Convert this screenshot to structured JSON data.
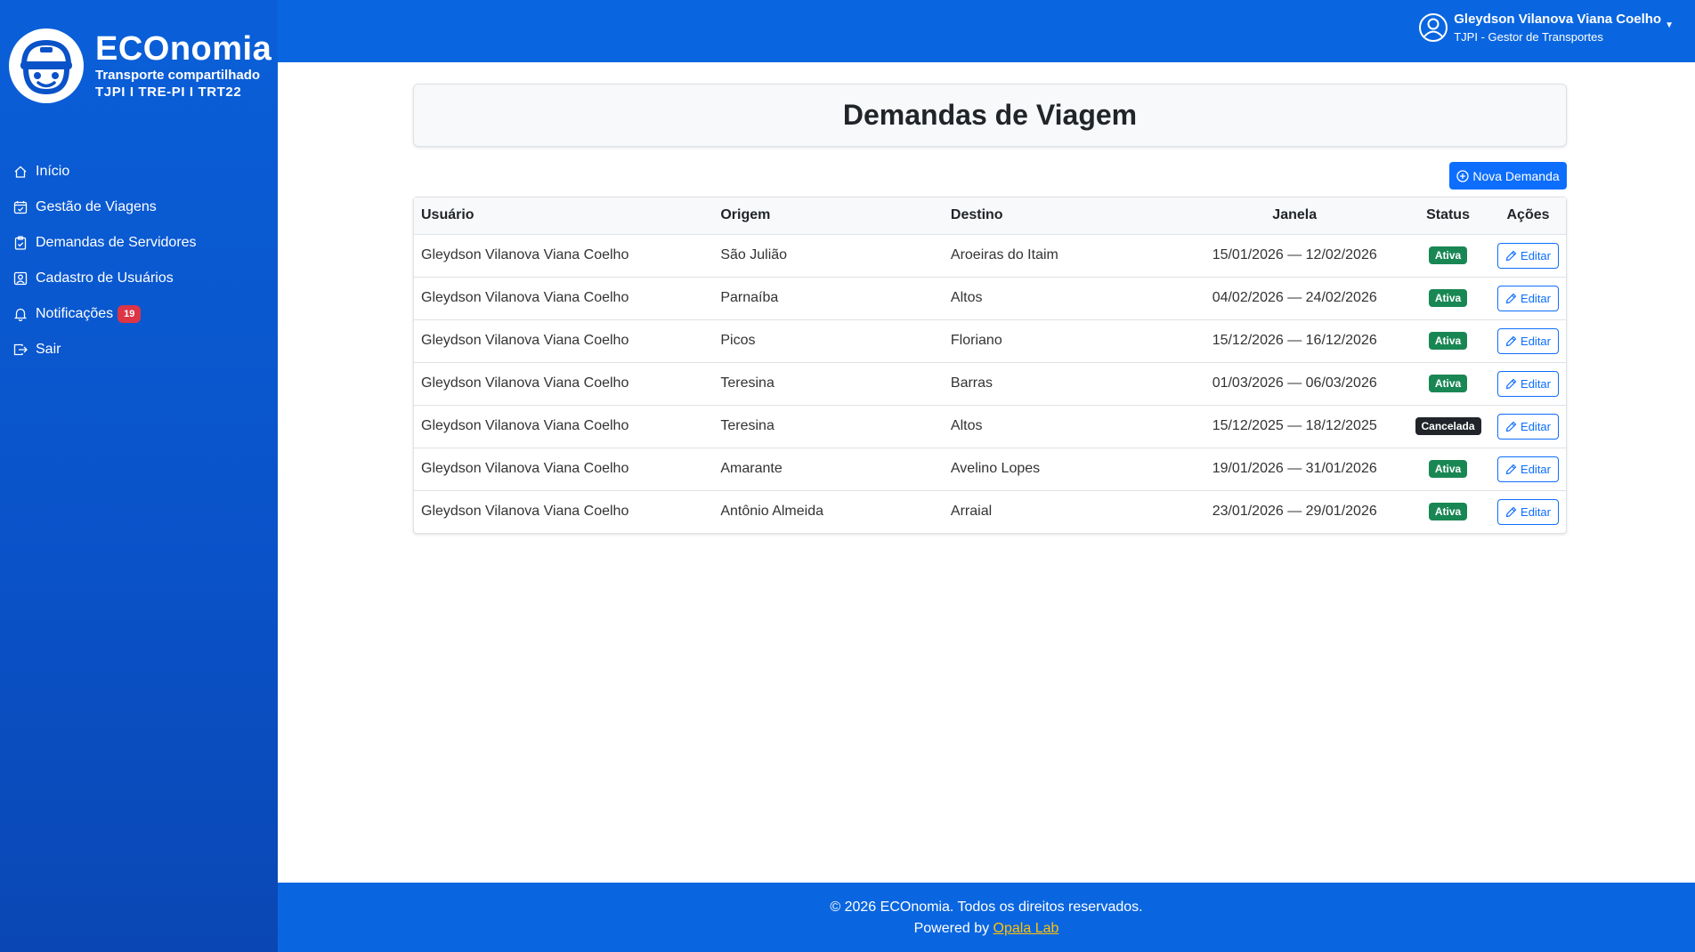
{
  "brand": {
    "name": "ECOnomia",
    "subtitle": "Transporte compartilhado",
    "orgs": "TJPI  I  TRE-PI  I  TRT22"
  },
  "sidebar": {
    "items": [
      {
        "label": "Início",
        "icon": "house-icon"
      },
      {
        "label": "Gestão de Viagens",
        "icon": "calendar-check-icon"
      },
      {
        "label": "Demandas de Servidores",
        "icon": "clipboard-check-icon"
      },
      {
        "label": "Cadastro de Usuários",
        "icon": "person-badge-icon"
      },
      {
        "label": "Notificações",
        "icon": "bell-icon",
        "badge": "19"
      },
      {
        "label": "Sair",
        "icon": "box-arrow-right-icon"
      }
    ]
  },
  "header": {
    "user_name": "Gleydson Vilanova Viana Coelho",
    "user_role": "TJPI - Gestor de Transportes"
  },
  "main": {
    "title": "Demandas de Viagem",
    "new_button": "Nova Demanda",
    "columns": [
      "Usuário",
      "Origem",
      "Destino",
      "Janela",
      "Status",
      "Ações"
    ],
    "edit_label": "Editar",
    "rows": [
      {
        "usuario": "Gleydson Vilanova Viana Coelho",
        "origem": "São Julião",
        "destino": "Aroeiras do Itaim",
        "janela": "15/01/2026 — 12/02/2026",
        "status": "Ativa"
      },
      {
        "usuario": "Gleydson Vilanova Viana Coelho",
        "origem": "Parnaíba",
        "destino": "Altos",
        "janela": "04/02/2026 — 24/02/2026",
        "status": "Ativa"
      },
      {
        "usuario": "Gleydson Vilanova Viana Coelho",
        "origem": "Picos",
        "destino": "Floriano",
        "janela": "15/12/2026 — 16/12/2026",
        "status": "Ativa"
      },
      {
        "usuario": "Gleydson Vilanova Viana Coelho",
        "origem": "Teresina",
        "destino": "Barras",
        "janela": "01/03/2026 — 06/03/2026",
        "status": "Ativa"
      },
      {
        "usuario": "Gleydson Vilanova Viana Coelho",
        "origem": "Teresina",
        "destino": "Altos",
        "janela": "15/12/2025 — 18/12/2025",
        "status": "Cancelada"
      },
      {
        "usuario": "Gleydson Vilanova Viana Coelho",
        "origem": "Amarante",
        "destino": "Avelino Lopes",
        "janela": "19/01/2026 — 31/01/2026",
        "status": "Ativa"
      },
      {
        "usuario": "Gleydson Vilanova Viana Coelho",
        "origem": "Antônio Almeida",
        "destino": "Arraial",
        "janela": "23/01/2026 — 29/01/2026",
        "status": "Ativa"
      }
    ]
  },
  "footer": {
    "copyright": "© 2026 ECOnomia. Todos os direitos reservados.",
    "powered_prefix": "Powered by",
    "powered_link": "Opala Lab"
  },
  "colors": {
    "sidebar": "#0a52c8",
    "header": "#0a66e0",
    "primary": "#0d6efd",
    "active": "#198754",
    "cancelled": "#212529",
    "badge": "#dc3545",
    "link": "#ffc107"
  }
}
